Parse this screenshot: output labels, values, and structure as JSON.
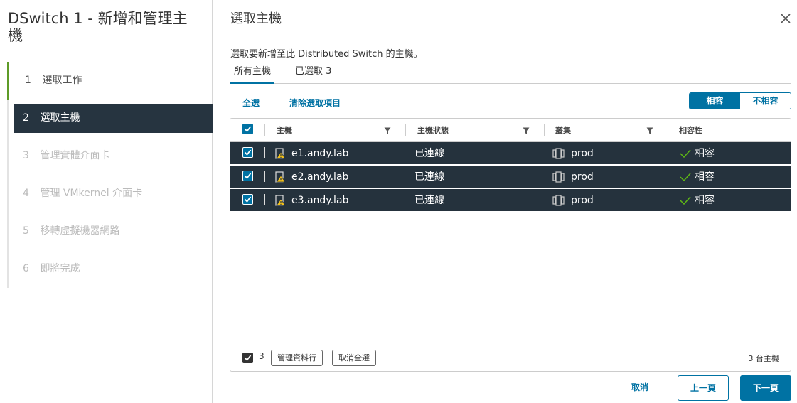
{
  "wizard": {
    "title": "DSwitch 1 - 新增和管理主機",
    "steps": [
      {
        "num": "1",
        "label": "選取工作",
        "state": "done"
      },
      {
        "num": "2",
        "label": "選取主機",
        "state": "active"
      },
      {
        "num": "3",
        "label": "管理實體介面卡",
        "state": "pending"
      },
      {
        "num": "4",
        "label": "管理 VMkernel 介面卡",
        "state": "pending"
      },
      {
        "num": "5",
        "label": "移轉虛擬機器網路",
        "state": "pending"
      },
      {
        "num": "6",
        "label": "即將完成",
        "state": "pending"
      }
    ]
  },
  "page": {
    "title": "選取主機",
    "description": "選取要新增至此 Distributed Switch 的主機。",
    "tabs": [
      "所有主機",
      "已選取 3"
    ],
    "select_all": "全選",
    "clear_selection": "清除選取項目",
    "toggle": {
      "on": "相容",
      "off": "不相容"
    }
  },
  "table": {
    "columns": [
      "主機",
      "主機狀態",
      "叢集",
      "相容性"
    ],
    "rows": [
      {
        "host": "e1.andy.lab",
        "status": "已連線",
        "cluster": "prod",
        "compat": "相容"
      },
      {
        "host": "e2.andy.lab",
        "status": "已連線",
        "cluster": "prod",
        "compat": "相容"
      },
      {
        "host": "e3.andy.lab",
        "status": "已連線",
        "cluster": "prod",
        "compat": "相容"
      }
    ],
    "footer": {
      "selected_count": "3",
      "manage_columns": "管理資料行",
      "deselect_all": "取消全選",
      "total": "3 台主機"
    }
  },
  "buttons": {
    "cancel": "取消",
    "back": "上一頁",
    "next": "下一頁"
  },
  "colors": {
    "accent": "#0072a3",
    "selected_row": "#25323d",
    "done_step": "#5e9b28",
    "warning": "#f5c21b",
    "ok_check": "#5eb715"
  }
}
